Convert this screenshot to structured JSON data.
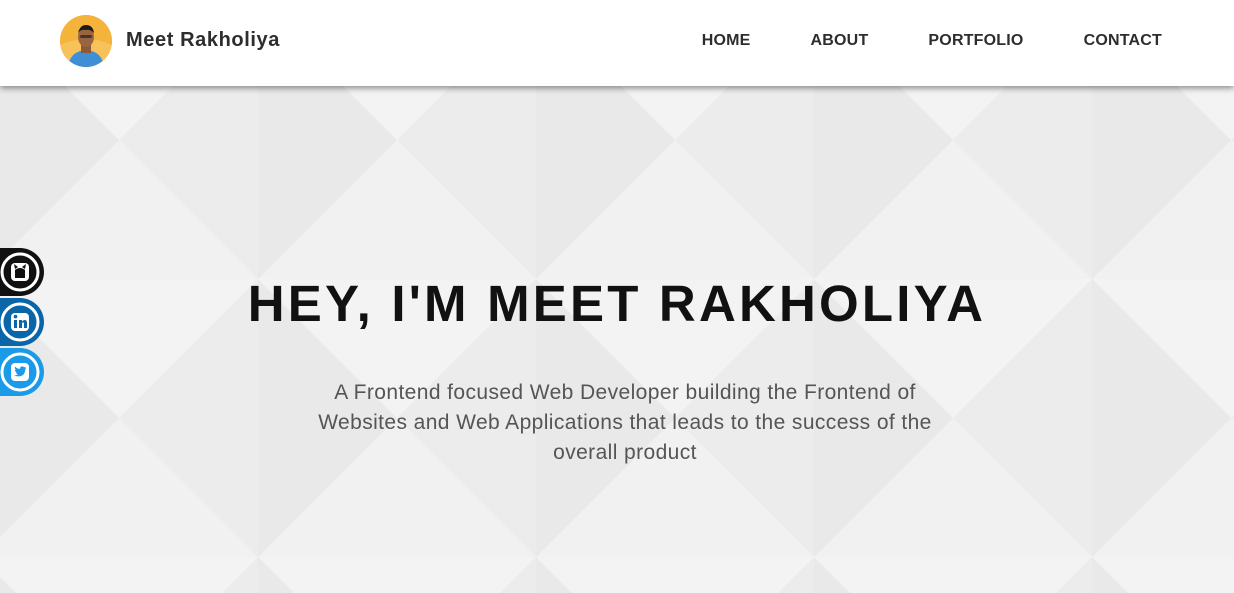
{
  "header": {
    "brand_name": "Meet Rakholiya",
    "avatar_icon": "profile-avatar",
    "nav": [
      {
        "label": "HOME"
      },
      {
        "label": "ABOUT"
      },
      {
        "label": "PORTFOLIO"
      },
      {
        "label": "CONTACT"
      }
    ]
  },
  "hero": {
    "title": "HEY, I'M MEET RAKHOLIYA",
    "subtitle": "A Frontend focused Web Developer building the Frontend of Websites and Web Applications that leads to the success of the overall product"
  },
  "social": [
    {
      "icon": "github-icon",
      "color": "#000000"
    },
    {
      "icon": "linkedin-icon",
      "color": "#0077b5"
    },
    {
      "icon": "twitter-icon",
      "color": "#1da1f2"
    }
  ],
  "colors": {
    "header_bg": "#ffffff",
    "hero_bg": "#efefef",
    "text_dark": "#111111",
    "text_muted": "#555555"
  }
}
